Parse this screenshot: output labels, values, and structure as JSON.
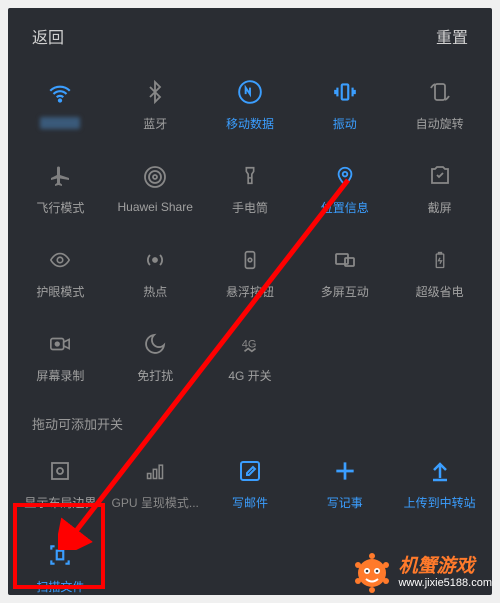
{
  "header": {
    "back": "返回",
    "reset": "重置"
  },
  "tiles": [
    {
      "id": "wifi",
      "label": "",
      "active": true,
      "icon": "wifi",
      "blur": true
    },
    {
      "id": "bluetooth",
      "label": "蓝牙",
      "active": false,
      "icon": "bluetooth"
    },
    {
      "id": "mobile-data",
      "label": "移动数据",
      "active": true,
      "icon": "mobile-data"
    },
    {
      "id": "vibrate",
      "label": "振动",
      "active": true,
      "icon": "vibrate"
    },
    {
      "id": "auto-rotate",
      "label": "自动旋转",
      "active": false,
      "icon": "rotate"
    },
    {
      "id": "airplane",
      "label": "飞行模式",
      "active": false,
      "icon": "airplane"
    },
    {
      "id": "huawei-share",
      "label": "Huawei Share",
      "active": false,
      "icon": "share"
    },
    {
      "id": "flashlight",
      "label": "手电筒",
      "active": false,
      "icon": "flashlight"
    },
    {
      "id": "location",
      "label": "位置信息",
      "active": true,
      "icon": "location"
    },
    {
      "id": "screenshot",
      "label": "截屏",
      "active": false,
      "icon": "screenshot"
    },
    {
      "id": "eye-comfort",
      "label": "护眼模式",
      "active": false,
      "icon": "eye"
    },
    {
      "id": "hotspot",
      "label": "热点",
      "active": false,
      "icon": "hotspot"
    },
    {
      "id": "floating",
      "label": "悬浮按钮",
      "active": false,
      "icon": "floating"
    },
    {
      "id": "multiscreen",
      "label": "多屏互动",
      "active": false,
      "icon": "multiscreen"
    },
    {
      "id": "ultra-save",
      "label": "超级省电",
      "active": false,
      "icon": "battery"
    },
    {
      "id": "screen-record",
      "label": "屏幕录制",
      "active": false,
      "icon": "record"
    },
    {
      "id": "dnd",
      "label": "免打扰",
      "active": false,
      "icon": "dnd"
    },
    {
      "id": "4g-switch",
      "label": "4G 开关",
      "active": false,
      "icon": "4g"
    }
  ],
  "section_title": "拖动可添加开关",
  "extra_tiles": [
    {
      "id": "layout-bounds",
      "label": "显示布局边界",
      "icon": "layout",
      "color": "#888"
    },
    {
      "id": "gpu-render",
      "label": "GPU 呈现模式...",
      "icon": "gpu",
      "color": "#888"
    },
    {
      "id": "compose-mail",
      "label": "写邮件",
      "icon": "compose",
      "color": "#3b9eff"
    },
    {
      "id": "write-note",
      "label": "写记事",
      "icon": "plus",
      "color": "#3b9eff"
    },
    {
      "id": "upload-transfer",
      "label": "上传到中转站",
      "icon": "upload",
      "color": "#3b9eff"
    },
    {
      "id": "scan-file",
      "label": "扫描文件",
      "icon": "scan",
      "color": "#3b9eff"
    }
  ],
  "watermark": {
    "brand": "机蟹游戏",
    "url": "www.jixie5188.com"
  },
  "colors": {
    "accent": "#3b9eff",
    "inactive": "#888",
    "annotation": "#ff0000",
    "brand": "#ff7a2b"
  }
}
